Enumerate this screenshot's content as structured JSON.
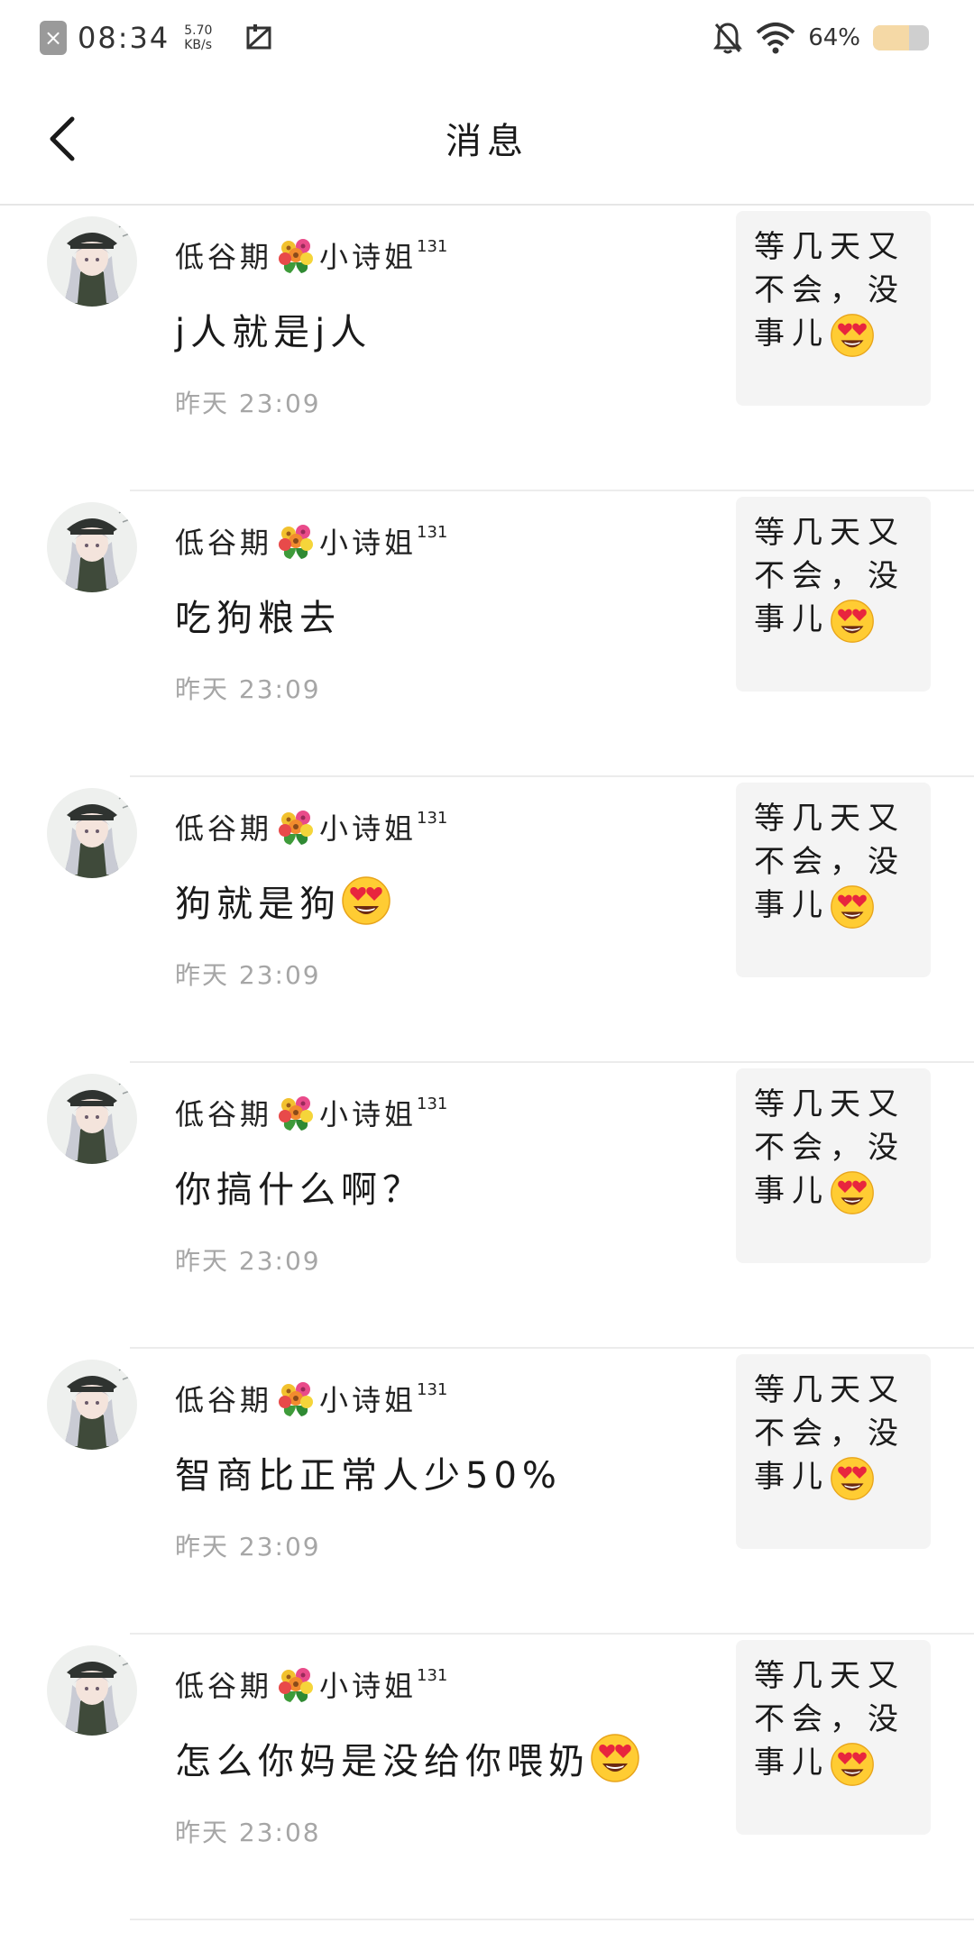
{
  "status_bar": {
    "close_glyph": "×",
    "time": "08:34",
    "speed_value": "5.70",
    "speed_unit": "KB/s",
    "battery_text": "64%",
    "battery_level": 0.64,
    "icons": [
      "notification-close-icon",
      "screenshot-icon",
      "mute-bell-icon",
      "wifi-icon",
      "battery-icon"
    ]
  },
  "header": {
    "title": "消息",
    "back_icon": "chevron-left-icon"
  },
  "colors": {
    "divider": "#ececec",
    "time_text": "#a6a6a6",
    "quote_bg": "#f4f4f4",
    "battery_fill": "#f5d9a6"
  },
  "messages": [
    {
      "name_before": "低谷期",
      "name_after": "小诗姐",
      "name_sup": "131",
      "text": "j人就是j人",
      "text_emoji": false,
      "time": "昨天 23:09",
      "quote": "等几天又不会，没事儿"
    },
    {
      "name_before": "低谷期",
      "name_after": "小诗姐",
      "name_sup": "131",
      "text": "吃狗粮去",
      "text_emoji": false,
      "time": "昨天 23:09",
      "quote": "等几天又不会，没事儿"
    },
    {
      "name_before": "低谷期",
      "name_after": "小诗姐",
      "name_sup": "131",
      "text": "狗就是狗",
      "text_emoji": true,
      "time": "昨天 23:09",
      "quote": "等几天又不会，没事儿"
    },
    {
      "name_before": "低谷期",
      "name_after": "小诗姐",
      "name_sup": "131",
      "text": "你搞什么啊？",
      "text_emoji": false,
      "time": "昨天 23:09",
      "quote": "等几天又不会，没事儿"
    },
    {
      "name_before": "低谷期",
      "name_after": "小诗姐",
      "name_sup": "131",
      "text": "智商比正常人少50%",
      "text_emoji": false,
      "time": "昨天 23:09",
      "quote": "等几天又不会，没事儿"
    },
    {
      "name_before": "低谷期",
      "name_after": "小诗姐",
      "name_sup": "131",
      "text": "怎么你妈是没给你喂奶",
      "text_emoji": true,
      "time": "昨天 23:08",
      "quote": "等几天又不会，没事儿"
    }
  ]
}
